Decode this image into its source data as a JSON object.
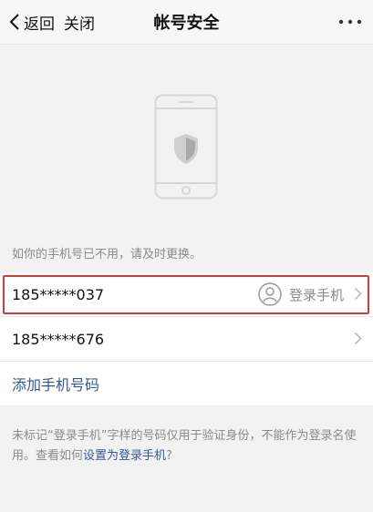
{
  "nav": {
    "back_label": "返回",
    "close_label": "关闭",
    "title": "帐号安全",
    "more_icon": "more-icon"
  },
  "hint": "如你的手机号已不用，请及时更换。",
  "phones": [
    {
      "number": "185*****037",
      "tag": "登录手机",
      "highlighted": true
    },
    {
      "number": "185*****676"
    }
  ],
  "add_phone_label": "添加手机号码",
  "note": {
    "text": "未标记“登录手机”字样的号码仅用于验证身份，不能作为登录名使用。查看如何",
    "link": "设置为登录手机",
    "suffix": "?"
  },
  "colors": {
    "accent": "#35588d",
    "highlight": "#d23b3b",
    "background": "#f2f2f2"
  }
}
